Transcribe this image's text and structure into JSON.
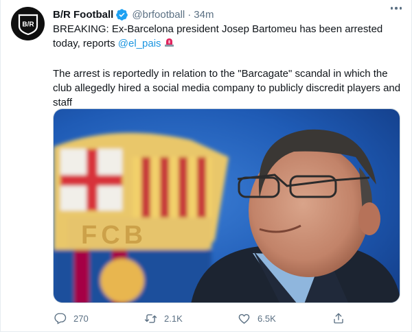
{
  "tweet": {
    "author_name": "B/R Football",
    "handle": "@brfootball",
    "separator": "·",
    "time": "34m",
    "avatar_text": "B/R",
    "text_line1": "BREAKING: Ex-Barcelona president Josep Bartomeu has been arrested today, reports ",
    "mention": "@el_pais",
    "text_para2": "The arrest is reportedly in relation to the \"Barcagate\" scandal in which the club allegedly hired a social media company to publicly discredit players and staff",
    "image_text": "FCB",
    "replies": "270",
    "retweets": "2.1K",
    "likes": "6.5K"
  },
  "colors": {
    "accent": "#1da1f2",
    "secondary_text": "#5b7083",
    "barca_blue": "#1c4f9c",
    "barca_red": "#a50044"
  },
  "icons": [
    "verified-badge-icon",
    "more-options-icon",
    "siren-icon",
    "reply-icon",
    "retweet-icon",
    "like-icon",
    "share-icon"
  ]
}
